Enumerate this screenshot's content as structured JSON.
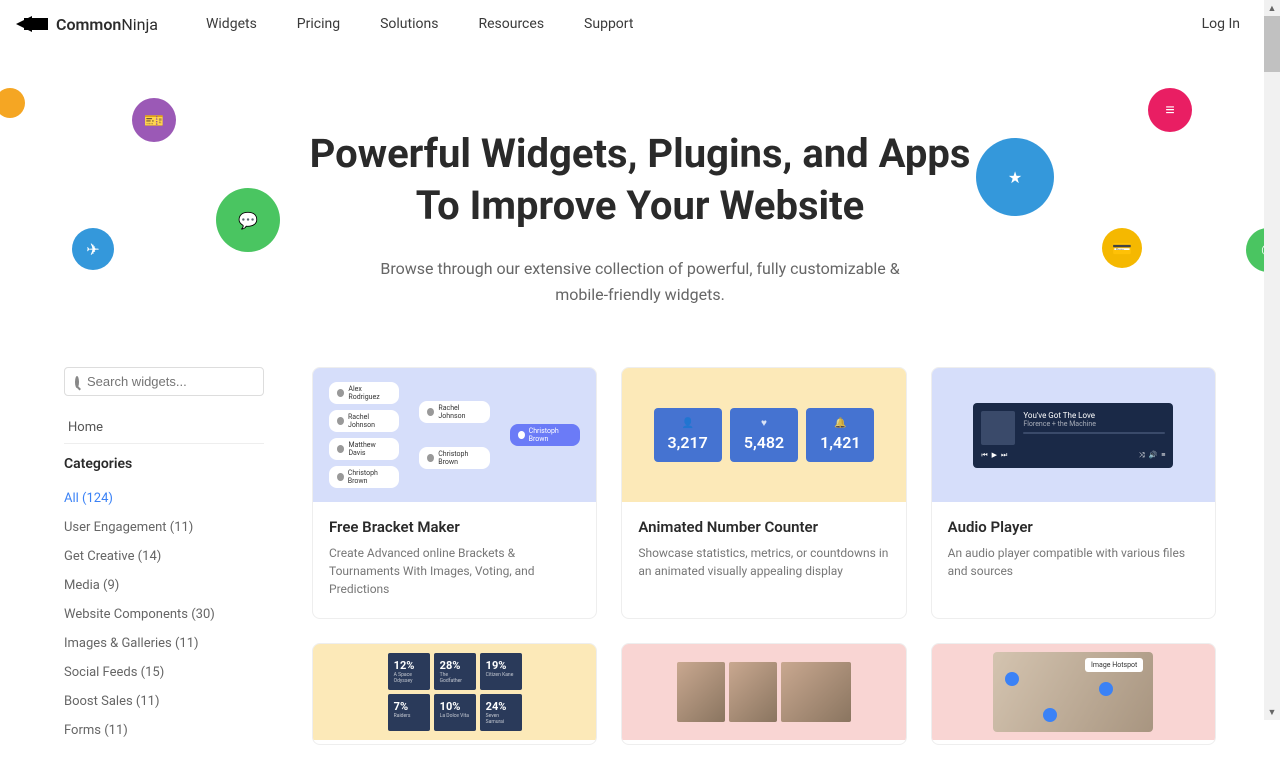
{
  "header": {
    "brand_a": "Common",
    "brand_b": "Ninja",
    "nav": [
      "Widgets",
      "Pricing",
      "Solutions",
      "Resources",
      "Support"
    ],
    "login": "Log In"
  },
  "hero": {
    "title": "Powerful Widgets, Plugins, and Apps To Improve Your Website",
    "subtitle": "Browse through our extensive collection of powerful, fully customizable & mobile-friendly widgets."
  },
  "sidebar": {
    "search_placeholder": "Search widgets...",
    "home": "Home",
    "heading": "Categories",
    "categories": [
      "All (124)",
      "User Engagement (11)",
      "Get Creative (14)",
      "Media (9)",
      "Website Components (30)",
      "Images & Galleries (11)",
      "Social Feeds (15)",
      "Boost Sales (11)",
      "Forms (11)"
    ]
  },
  "cards": [
    {
      "title": "Free Bracket Maker",
      "desc": "Create Advanced online Brackets & Tournaments With Images, Voting, and Predictions"
    },
    {
      "title": "Animated Number Counter",
      "desc": "Showcase statistics, metrics, or countdowns in an animated visually appealing display"
    },
    {
      "title": "Audio Player",
      "desc": "An audio player compatible with various files and sources"
    }
  ],
  "mock": {
    "bracket_names": [
      "Alex Rodriguez",
      "Rachel Johnson",
      "Matthew Davis",
      "Christoph Brown",
      "Rachel Johnson",
      "Christoph Brown",
      "Christoph Brown"
    ],
    "counter": [
      "3,217",
      "5,482",
      "1,421"
    ],
    "audio_title": "You've Got The Love",
    "audio_sub": "Florence + the Machine",
    "pct": [
      "12%",
      "28%",
      "19%",
      "7%",
      "10%",
      "24%"
    ],
    "hotspot_label": "Image Hotspot"
  }
}
